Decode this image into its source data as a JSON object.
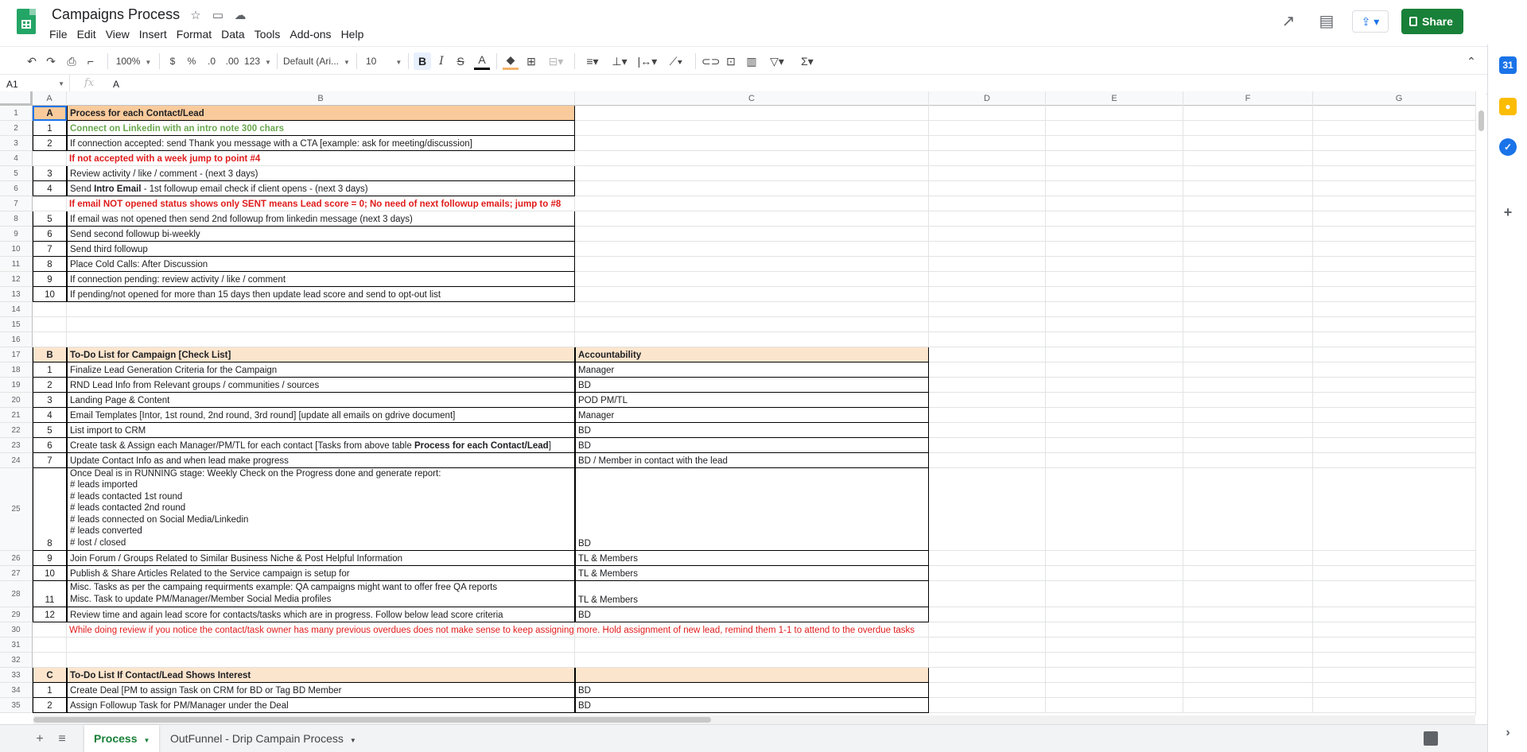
{
  "doc": {
    "title": "Campaigns Process"
  },
  "menu": [
    "File",
    "Edit",
    "View",
    "Insert",
    "Format",
    "Data",
    "Tools",
    "Add-ons",
    "Help"
  ],
  "header": {
    "share_label": "Share"
  },
  "toolbar": {
    "zoom": "100%",
    "currency": "$",
    "percent": "%",
    "dec_minus": ".0",
    "dec_plus": ".00",
    "more_formats": "123",
    "font": "Default (Ari...",
    "font_size": "10",
    "bold": "B",
    "italic": "I",
    "strike": "S",
    "text_color": "A"
  },
  "formula": {
    "name_box": "A1",
    "fx": "fx",
    "value": "A"
  },
  "columns": [
    "A",
    "B",
    "C",
    "D",
    "E",
    "F",
    "G"
  ],
  "rows": [
    {
      "n": "1",
      "a": "A",
      "b": "Process for each Contact/Lead",
      "c": ""
    },
    {
      "n": "2",
      "a": "1",
      "b": "Connect on Linkedin with an intro note 300 chars",
      "c": ""
    },
    {
      "n": "3",
      "a": "2",
      "b": "If connection accepted: send Thank you message with a CTA [example: ask for meeting/discussion]",
      "c": ""
    },
    {
      "n": "4",
      "a": "",
      "b": "If not accepted with a week jump to point #4",
      "c": ""
    },
    {
      "n": "5",
      "a": "3",
      "b": "Review activity / like / comment - (next 3 days)",
      "c": ""
    },
    {
      "n": "6",
      "a": "4",
      "b_pre": "Send ",
      "b_bold": "Intro Email",
      "b_post": " - 1st followup email check if client opens - (next 3 days)",
      "c": ""
    },
    {
      "n": "7",
      "a": "",
      "b": "If email NOT opened status shows only SENT means Lead score = 0; No need of next followup emails; jump to #8",
      "c": ""
    },
    {
      "n": "8",
      "a": "5",
      "b": "If email was not opened then send 2nd followup from linkedin message (next 3 days)",
      "c": ""
    },
    {
      "n": "9",
      "a": "6",
      "b": "Send second followup bi-weekly",
      "c": ""
    },
    {
      "n": "10",
      "a": "7",
      "b": "Send third followup",
      "c": ""
    },
    {
      "n": "11",
      "a": "8",
      "b": "Place Cold Calls: After Discussion",
      "c": ""
    },
    {
      "n": "12",
      "a": "9",
      "b": "If connection pending: review activity / like / comment",
      "c": ""
    },
    {
      "n": "13",
      "a": "10",
      "b": "If pending/not opened for more than 15 days then update lead score and send to opt-out list",
      "c": ""
    },
    {
      "n": "14",
      "a": "",
      "b": "",
      "c": ""
    },
    {
      "n": "15",
      "a": "",
      "b": "",
      "c": ""
    },
    {
      "n": "16",
      "a": "",
      "b": "",
      "c": ""
    },
    {
      "n": "17",
      "a": "B",
      "b": "To-Do List for Campaign [Check List]",
      "c": "Accountability"
    },
    {
      "n": "18",
      "a": "1",
      "b": "Finalize Lead Generation Criteria for the Campaign",
      "c": "Manager"
    },
    {
      "n": "19",
      "a": "2",
      "b": "RND Lead Info from Relevant groups / communities / sources",
      "c": "BD"
    },
    {
      "n": "20",
      "a": "3",
      "b": "Landing Page & Content",
      "c": "POD PM/TL"
    },
    {
      "n": "21",
      "a": "4",
      "b": "Email Templates [Intor, 1st round, 2nd round, 3rd round] [update all emails on gdrive document]",
      "c": "Manager"
    },
    {
      "n": "22",
      "a": "5",
      "b": "List import to CRM",
      "c": "BD"
    },
    {
      "n": "23",
      "a": "6",
      "b_pre": "Create task & Assign each Manager/PM/TL for each contact [Tasks from above table ",
      "b_bold": "Process for each Contact/Lead",
      "b_post": "]",
      "c": "BD"
    },
    {
      "n": "24",
      "a": "7",
      "b": "Update Contact Info as and when lead make progress",
      "c": "BD / Member in contact with the lead"
    },
    {
      "n": "25",
      "a": "8",
      "b": "Once Deal is in RUNNING stage: Weekly Check on the Progress done and generate report:\n# leads imported\n# leads contacted 1st round\n# leads contacted 2nd round\n# leads connected on Social Media/Linkedin\n# leads converted\n# lost / closed",
      "c": "BD"
    },
    {
      "n": "26",
      "a": "9",
      "b": "Join Forum / Groups Related to Similar Business Niche & Post Helpful Information",
      "c": "TL & Members"
    },
    {
      "n": "27",
      "a": "10",
      "b": "Publish & Share Articles Related to the Service campaign is setup for",
      "c": "TL & Members"
    },
    {
      "n": "28",
      "a": "11",
      "b": "Misc. Tasks as per the campaing requirments example: QA campaigns might want to offer free QA reports\nMisc. Task to update PM/Manager/Member Social Media profiles",
      "c": "TL & Members"
    },
    {
      "n": "29",
      "a": "12",
      "b": "Review time and again lead score for contacts/tasks which are in progress. Follow below lead score criteria",
      "c": "BD"
    },
    {
      "n": "30",
      "a": "",
      "b": "While doing review if you notice the contact/task owner has many previous overdues does not make sense to keep assigning more. Hold assignment of new lead, remind them 1-1 to attend to the overdue tasks",
      "c": ""
    },
    {
      "n": "31",
      "a": "",
      "b": "",
      "c": ""
    },
    {
      "n": "32",
      "a": "",
      "b": "",
      "c": ""
    },
    {
      "n": "33",
      "a": "C",
      "b": "To-Do List If Contact/Lead Shows Interest",
      "c": ""
    },
    {
      "n": "34",
      "a": "1",
      "b": "Create Deal [PM to assign Task on CRM for BD or Tag BD Member",
      "c": "BD"
    },
    {
      "n": "35",
      "a": "2",
      "b": "Assign Followup Task for PM/Manager under the Deal",
      "c": "BD"
    }
  ],
  "sheets": [
    {
      "label": "Process",
      "active": true
    },
    {
      "label": "OutFunnel - Drip Campain Process",
      "active": false
    }
  ],
  "colors": {
    "brand": "#188038",
    "header_orange": "#f9cb9c",
    "header_light": "#fce5cd",
    "green_text": "#6aa84f",
    "red_text": "#e01b1b",
    "selection": "#1a73e8"
  }
}
